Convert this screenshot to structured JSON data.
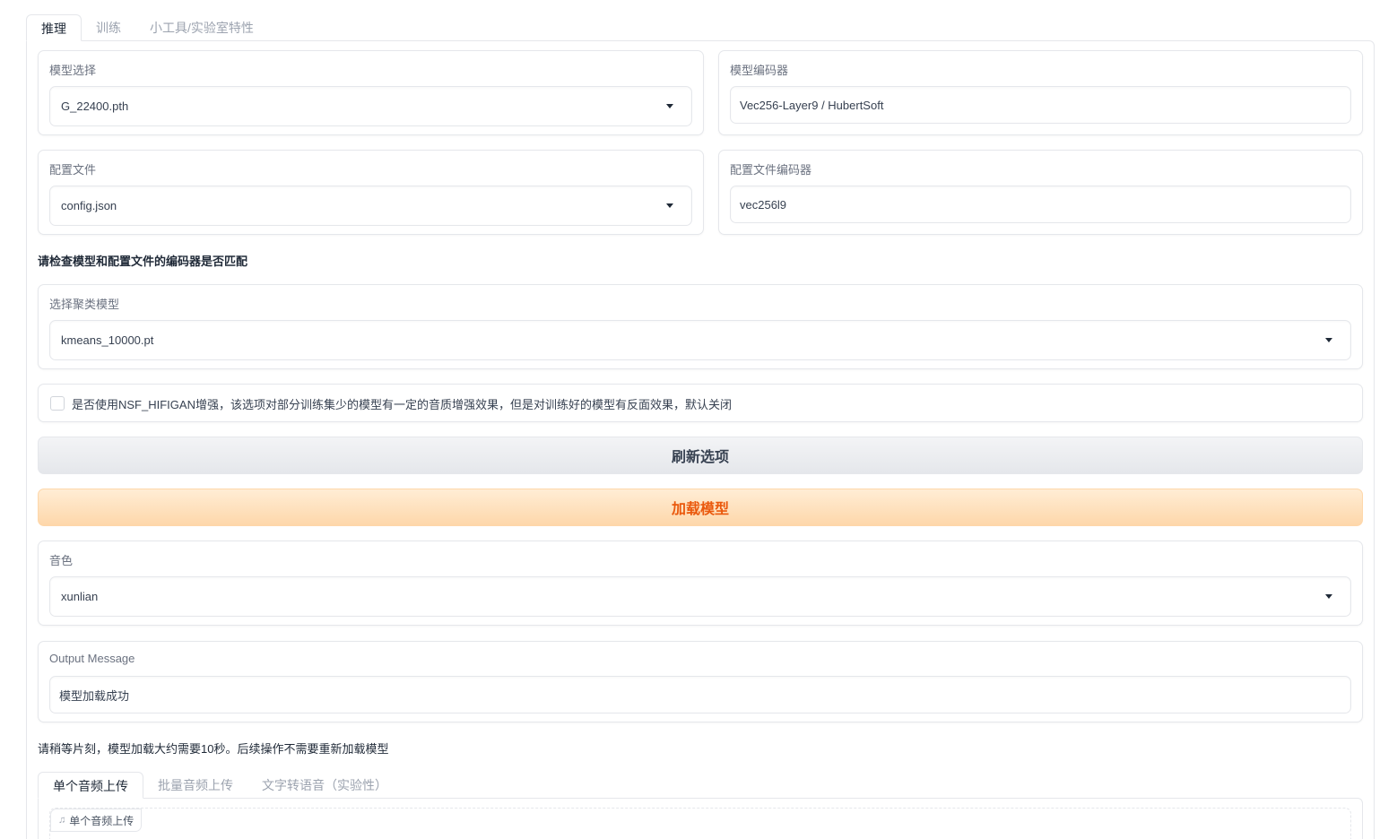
{
  "main_tabs": [
    {
      "label": "推理",
      "active": true
    },
    {
      "label": "训练",
      "active": false
    },
    {
      "label": "小工具/实验室特性",
      "active": false
    }
  ],
  "model_select": {
    "label": "模型选择",
    "value": "G_22400.pth"
  },
  "model_encoder": {
    "label": "模型编码器",
    "value": "Vec256-Layer9 / HubertSoft"
  },
  "config_file": {
    "label": "配置文件",
    "value": "config.json"
  },
  "config_encoder": {
    "label": "配置文件编码器",
    "value": "vec256l9"
  },
  "encoder_warning": "请检查模型和配置文件的编码器是否匹配",
  "cluster_model": {
    "label": "选择聚类模型",
    "value": "kmeans_10000.pt"
  },
  "nsf_hifigan": {
    "label": "是否使用NSF_HIFIGAN增强，该选项对部分训练集少的模型有一定的音质增强效果，但是对训练好的模型有反面效果，默认关闭",
    "checked": false
  },
  "refresh_button": "刷新选项",
  "load_button": "加载模型",
  "speaker": {
    "label": "音色",
    "value": "xunlian"
  },
  "output_message": {
    "label": "Output Message",
    "value": "模型加载成功"
  },
  "load_note": "请稍等片刻，模型加载大约需要10秒。后续操作不需要重新加载模型",
  "audio_tabs": [
    {
      "label": "单个音频上传",
      "active": true
    },
    {
      "label": "批量音频上传",
      "active": false
    },
    {
      "label": "文字转语音（实验性）",
      "active": false
    }
  ],
  "audio_upload": {
    "label": "单个音频上传",
    "icon": "music-note-icon"
  },
  "colors": {
    "primary_text": "#ea580c",
    "primary_bg": "#fed7aa",
    "border": "#e5e7eb"
  }
}
